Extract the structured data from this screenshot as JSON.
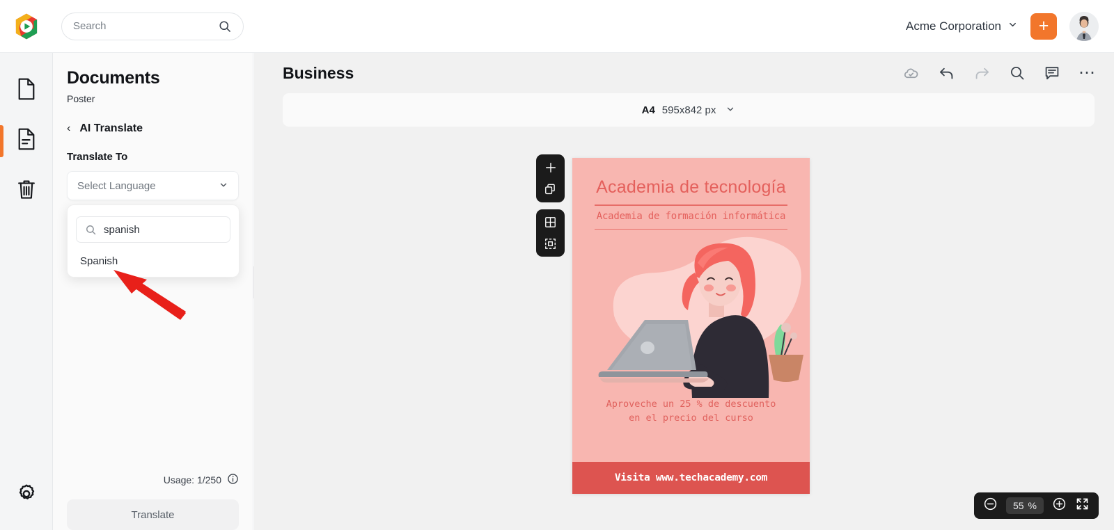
{
  "topbar": {
    "logo_icon": "app-logo-hexagon-play",
    "search": {
      "placeholder": "Search",
      "icon": "search-icon"
    },
    "org_name": "Acme Corporation",
    "org_chevron_icon": "chevron-down-icon",
    "add_button_label": "+",
    "avatar_icon": "user-avatar"
  },
  "rail": {
    "items": [
      {
        "name": "documents",
        "icon": "blank-page-icon",
        "active": false
      },
      {
        "name": "pages",
        "icon": "lined-page-icon",
        "active": true
      },
      {
        "name": "trash",
        "icon": "trash-icon",
        "active": false
      }
    ],
    "settings": {
      "name": "settings",
      "icon": "gear-icon"
    }
  },
  "panel": {
    "title": "Documents",
    "subtitle": "Poster",
    "back": {
      "chevron": "‹",
      "label": "AI Translate"
    },
    "field_label": "Translate To",
    "select": {
      "value": "Select Language",
      "chevron_icon": "chevron-down-icon"
    },
    "dropdown": {
      "search_value": "spanish",
      "search_icon": "search-icon",
      "options": [
        "Spanish"
      ]
    },
    "usage_text": "Usage: 1/250",
    "usage_info_icon": "info-icon",
    "translate_button": "Translate",
    "collapse_handle_icon": "chevron-left-icon"
  },
  "main": {
    "title": "Business",
    "tools": [
      {
        "name": "cloud-saved",
        "icon": "cloud-check-icon",
        "dim": false
      },
      {
        "name": "undo",
        "icon": "undo-arrow-icon",
        "dim": false
      },
      {
        "name": "redo",
        "icon": "redo-arrow-icon",
        "dim": true
      },
      {
        "name": "search",
        "icon": "search-icon",
        "dim": false
      },
      {
        "name": "comments",
        "icon": "comment-icon",
        "dim": false
      },
      {
        "name": "more",
        "icon": "ellipsis-icon",
        "dim": false
      }
    ],
    "size_bar": {
      "preset": "A4",
      "dimensions": "595x842 px",
      "chevron_icon": "chevron-down-icon"
    },
    "canvas_tools_group_1": [
      {
        "name": "add-page",
        "icon": "plus-icon"
      },
      {
        "name": "duplicate-page",
        "icon": "copy-icon"
      }
    ],
    "canvas_tools_group_2": [
      {
        "name": "grid-view",
        "icon": "grid-icon"
      },
      {
        "name": "select-area",
        "icon": "dashed-select-icon"
      }
    ],
    "zoom": {
      "minus_icon": "minus-circle-icon",
      "level": "55",
      "percent_symbol": "%",
      "plus_icon": "plus-circle-icon",
      "fullscreen_icon": "fullscreen-icon"
    }
  },
  "poster": {
    "title": "Academia de tecnología",
    "subtitle": "Academia de formación informática",
    "promo_line1": "Aproveche un 25 % de descuento",
    "promo_line2": "en el precio del curso",
    "footer_band": "Visita www.techacademy.com",
    "colors": {
      "background": "#f8b6b0",
      "accent_text": "#e4605c",
      "band": "#dd5450",
      "blob": "#fcd4d0"
    }
  },
  "annotation": {
    "arrow_color": "#e8201a",
    "points_at": "Spanish"
  }
}
